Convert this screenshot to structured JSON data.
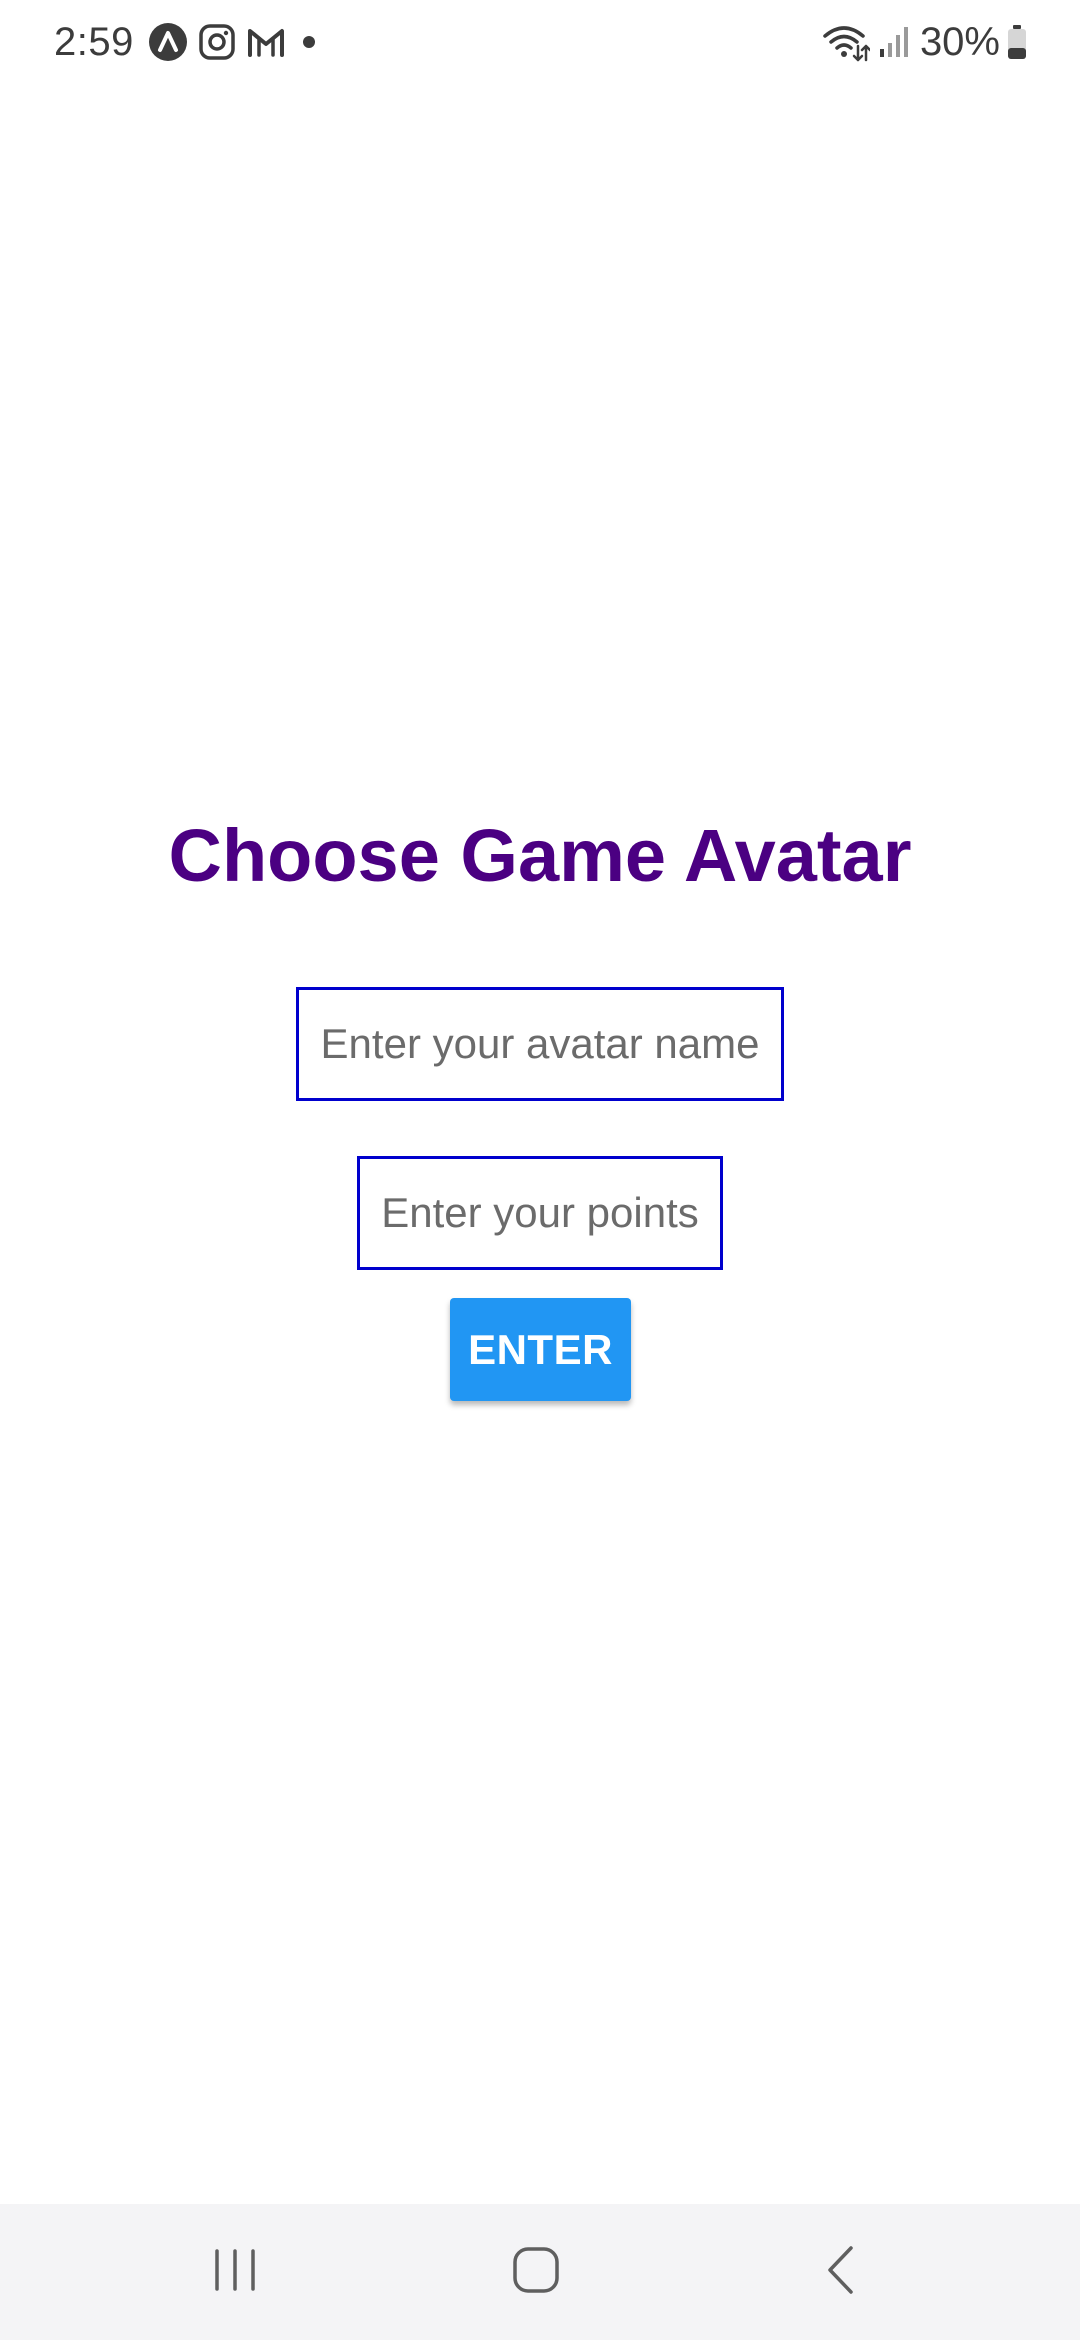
{
  "status_bar": {
    "time": "2:59",
    "notification_icons": [
      "app-a-icon",
      "instagram-icon",
      "gmail-icon",
      "dot-icon"
    ],
    "system_icons": [
      "wifi-icon",
      "signal-icon",
      "battery-icon"
    ],
    "battery_percent": "30%"
  },
  "screen": {
    "title": "Choose Game Avatar",
    "avatar_name_input": {
      "value": "",
      "placeholder": "Enter your avatar name"
    },
    "points_input": {
      "value": "",
      "placeholder": "Enter your points"
    },
    "enter_button_label": "ENTER"
  },
  "nav_bar": {
    "buttons": [
      "recents-icon",
      "home-icon",
      "back-icon"
    ]
  },
  "colors": {
    "title": "#4b0082",
    "input_border": "#0000cd",
    "button_background": "#2196f3",
    "button_text": "#ffffff",
    "nav_background": "#f4f4f6"
  }
}
